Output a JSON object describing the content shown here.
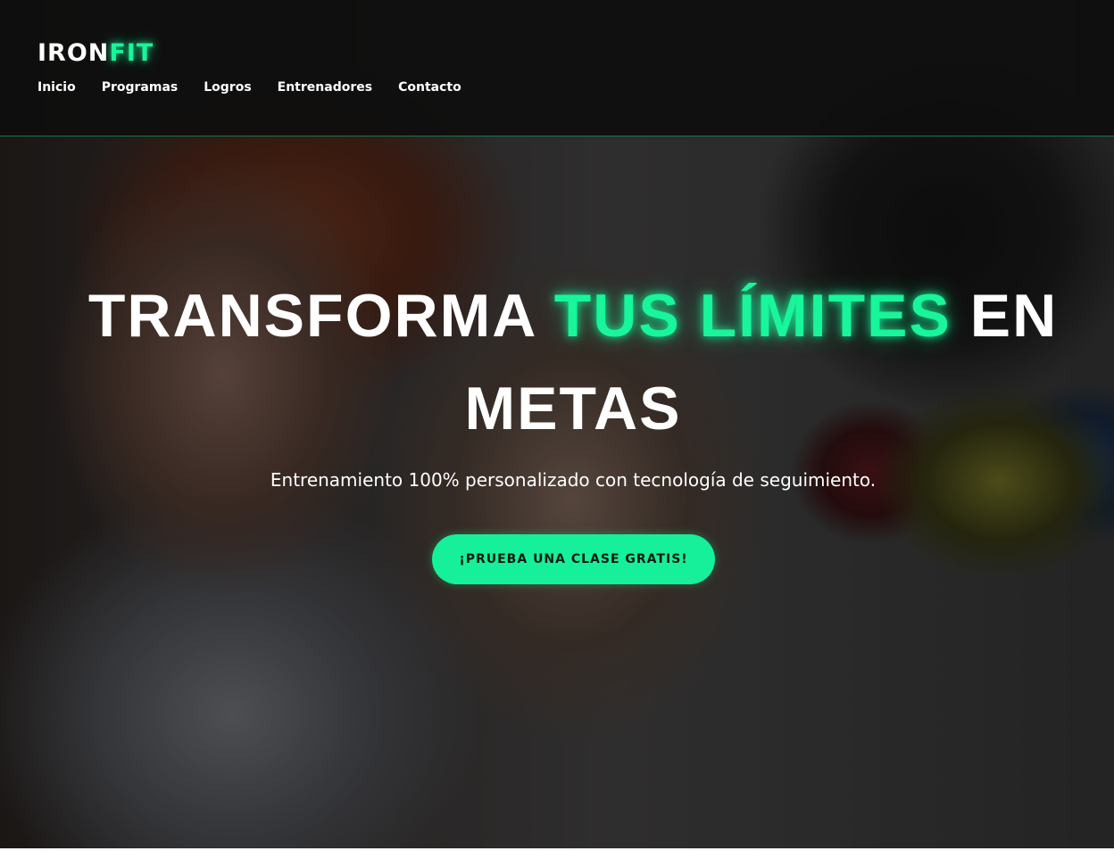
{
  "brand": {
    "name_main": "IRON",
    "name_accent": "FIT",
    "accent_color": "#18f59b"
  },
  "nav": {
    "items": [
      {
        "label": "Inicio"
      },
      {
        "label": "Programas"
      },
      {
        "label": "Logros"
      },
      {
        "label": "Entrenadores"
      },
      {
        "label": "Contacto"
      }
    ]
  },
  "hero": {
    "headline_part1": "TRANSFORMA",
    "headline_highlight": "TUS LÍMITES",
    "headline_part2": "EN METAS",
    "subtitle": "Entrenamiento 100% personalizado con tecnología de seguimiento.",
    "cta_label": "¡PRUEBA UNA CLASE GRATIS!",
    "cta_color": "#16f09a"
  }
}
